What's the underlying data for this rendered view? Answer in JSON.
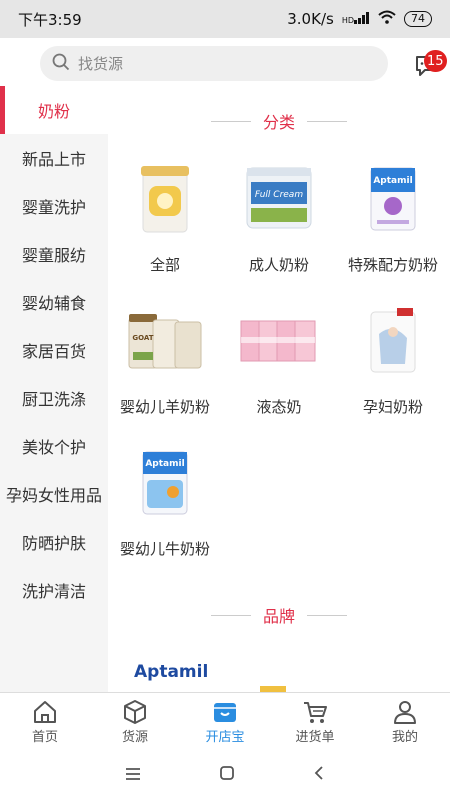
{
  "status": {
    "time": "下午3:59",
    "network_speed": "3.0K/s",
    "network_type": "HD",
    "battery": "74"
  },
  "search": {
    "placeholder": "找货源"
  },
  "messages": {
    "badge_count": "15"
  },
  "sidebar": {
    "items": [
      {
        "label": "奶粉",
        "active": true
      },
      {
        "label": "新品上市"
      },
      {
        "label": "婴童洗护"
      },
      {
        "label": "婴童服纺"
      },
      {
        "label": "婴幼辅食"
      },
      {
        "label": "家居百货"
      },
      {
        "label": "厨卫洗涤"
      },
      {
        "label": "美妆个护"
      },
      {
        "label": "孕妈女性用品"
      },
      {
        "label": "防晒护肤"
      },
      {
        "label": "洗护清洁"
      }
    ]
  },
  "category": {
    "title": "分类",
    "items": [
      {
        "label": "全部"
      },
      {
        "label": "成人奶粉",
        "product_text": "Full Cream"
      },
      {
        "label": "特殊配方奶粉",
        "product_text": "Aptamil"
      },
      {
        "label": "婴幼儿羊奶粉",
        "product_text": "GOAT"
      },
      {
        "label": "液态奶"
      },
      {
        "label": "孕妇奶粉"
      },
      {
        "label": "婴幼儿牛奶粉",
        "product_text": "Aptamil"
      }
    ]
  },
  "brand": {
    "title": "品牌",
    "logo_text": "Aptamil"
  },
  "tabbar": {
    "items": [
      {
        "label": "首页",
        "icon": "home-icon"
      },
      {
        "label": "货源",
        "icon": "box-icon"
      },
      {
        "label": "开店宝",
        "icon": "shop-icon",
        "active": true
      },
      {
        "label": "进货单",
        "icon": "cart-icon"
      },
      {
        "label": "我的",
        "icon": "user-icon"
      }
    ]
  },
  "colors": {
    "accent": "#e0304a",
    "tab_active": "#2a8de0",
    "badge": "#e02020"
  }
}
